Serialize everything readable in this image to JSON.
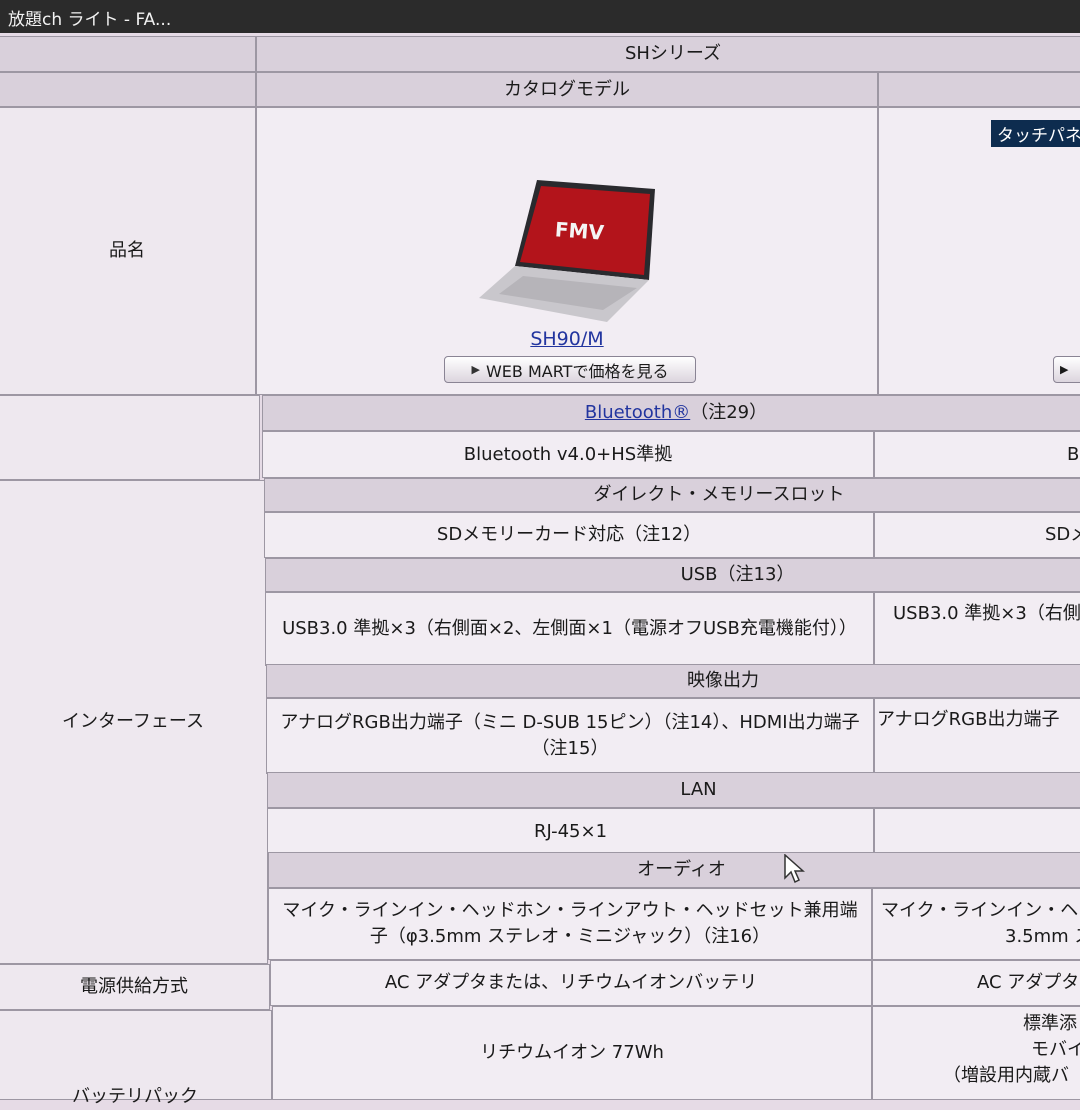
{
  "window": {
    "title": "放題ch ライト - FA..."
  },
  "header": {
    "series": "SHシリーズ",
    "catalog_model": "カタログモデル"
  },
  "product": {
    "row_label": "品名",
    "screen_logo": "FMV",
    "model": "SH90/M",
    "buy_button": "WEB MARTで価格を見る",
    "touch_badge": "タッチパネ"
  },
  "bluetooth": {
    "link": "Bluetooth®",
    "note": "（注29）",
    "value": "Bluetooth v4.0+HS準拠",
    "value_right": "B"
  },
  "interface": {
    "row_label": "インターフェース",
    "direct_memory": {
      "header": "ダイレクト・メモリースロット",
      "value": "SDメモリーカード対応（注12）",
      "value_right": "SDメ"
    },
    "usb": {
      "header": "USB（注13）",
      "value": "USB3.0 準拠×3（右側面×2、左側面×1（電源オフUSB充電機能付））",
      "value_right": "USB3.0 準拠×3（右側"
    },
    "video": {
      "header": "映像出力",
      "value": "アナログRGB出力端子（ミニ D-SUB 15ピン）（注14）、HDMI出力端子（注15）",
      "value_right": "アナログRGB出力端子"
    },
    "lan": {
      "header": "LAN",
      "value": "RJ-45×1",
      "value_right": ""
    },
    "audio": {
      "header": "オーディオ",
      "value": "マイク・ラインイン・ヘッドホン・ラインアウト・ヘッドセット兼用端子（φ3.5mm ステレオ・ミニジャック）（注16）",
      "value_right_1": "マイク・ラインイン・ヘッ",
      "value_right_2": "3.5mm ス"
    }
  },
  "power": {
    "row_label": "電源供給方式",
    "value": "AC アダプタまたは、リチウムイオンバッテリ",
    "value_right": "AC アダプタ"
  },
  "battery": {
    "row_label": "バッテリパック",
    "value": "リチウムイオン 77Wh",
    "value_right_1": "標準添",
    "value_right_2": "モバイ",
    "value_right_3": "（増設用内蔵バ"
  },
  "colors": {
    "header_bg": "#d9d0db",
    "cell_bg": "#f2edf3",
    "link": "#22359f",
    "badge": "#0d2c4f",
    "screen_red": "#b3141b"
  }
}
